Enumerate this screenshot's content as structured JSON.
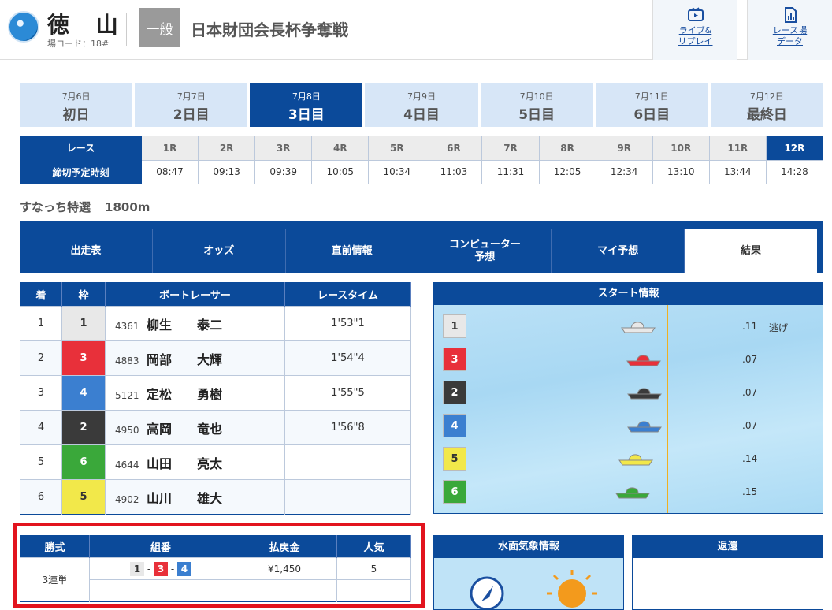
{
  "header": {
    "venue": "徳 山",
    "code": "場コード：18#",
    "grade": "一般",
    "race_title": "日本財団会長杯争奪戦",
    "live_btn": [
      "ライブ&",
      "リプレイ"
    ],
    "data_btn": [
      "レース場",
      "データ"
    ]
  },
  "days": [
    {
      "date": "7月6日",
      "name": "初日"
    },
    {
      "date": "7月7日",
      "name": "2日目"
    },
    {
      "date": "7月8日",
      "name": "3日目",
      "active": true
    },
    {
      "date": "7月9日",
      "name": "4日目"
    },
    {
      "date": "7月10日",
      "name": "5日目"
    },
    {
      "date": "7月11日",
      "name": "6日目"
    },
    {
      "date": "7月12日",
      "name": "最終日"
    }
  ],
  "race_table": {
    "race_label": "レース",
    "time_label": "締切予定時刻",
    "races": [
      "1R",
      "2R",
      "3R",
      "4R",
      "5R",
      "6R",
      "7R",
      "8R",
      "9R",
      "10R",
      "11R",
      "12R"
    ],
    "times": [
      "08:47",
      "09:13",
      "09:39",
      "10:05",
      "10:34",
      "11:03",
      "11:31",
      "12:05",
      "12:34",
      "13:10",
      "13:44",
      "14:28"
    ],
    "active_index": 11
  },
  "race_name": "すなっち特選",
  "distance": "1800m",
  "tabs": [
    "出走表",
    "オッズ",
    "直前情報",
    "コンピューター|予想",
    "マイ予想",
    "結果"
  ],
  "results": {
    "headers": [
      "着",
      "枠",
      "ボートレーサー",
      "レースタイム"
    ],
    "rows": [
      {
        "pos": "1",
        "frame": "1",
        "id": "4361",
        "name": "柳生　　泰二",
        "time": "1'53\"1"
      },
      {
        "pos": "2",
        "frame": "3",
        "id": "4883",
        "name": "岡部　　大輝",
        "time": "1'54\"4"
      },
      {
        "pos": "3",
        "frame": "4",
        "id": "5121",
        "name": "定松　　勇樹",
        "time": "1'55\"5"
      },
      {
        "pos": "4",
        "frame": "2",
        "id": "4950",
        "name": "高岡　　竜也",
        "time": "1'56\"8"
      },
      {
        "pos": "5",
        "frame": "6",
        "id": "4644",
        "name": "山田　　亮太",
        "time": ""
      },
      {
        "pos": "6",
        "frame": "5",
        "id": "4902",
        "name": "山川　　雄大",
        "time": ""
      }
    ]
  },
  "start_info": {
    "title": "スタート情報",
    "rows": [
      {
        "frame": "1",
        "st": ".11",
        "note": "逃げ"
      },
      {
        "frame": "3",
        "st": ".07",
        "note": ""
      },
      {
        "frame": "2",
        "st": ".07",
        "note": ""
      },
      {
        "frame": "4",
        "st": ".07",
        "note": ""
      },
      {
        "frame": "5",
        "st": ".14",
        "note": ""
      },
      {
        "frame": "6",
        "st": ".15",
        "note": ""
      }
    ]
  },
  "payout": {
    "headers": [
      "勝式",
      "組番",
      "払戻金",
      "人気"
    ],
    "bet_type": "3連単",
    "combo": [
      "1",
      "3",
      "4"
    ],
    "amount": "¥1,450",
    "popularity": "5"
  },
  "weather": {
    "title": "水面気象情報"
  },
  "refund": {
    "title": "返還"
  },
  "colors": {
    "frame1": "#e8e8e8",
    "frame2": "#3a3a3a",
    "frame3": "#e8303a",
    "frame4": "#3b7fd0",
    "frame5": "#f2e84a",
    "frame6": "#3aa83a",
    "navy": "#0b4a9a"
  }
}
